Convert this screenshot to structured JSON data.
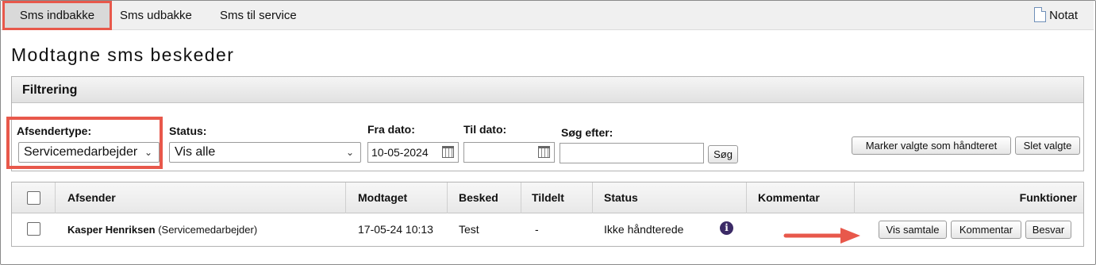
{
  "tabs": [
    {
      "label": "Sms indbakke",
      "active": true
    },
    {
      "label": "Sms udbakke",
      "active": false
    },
    {
      "label": "Sms til service",
      "active": false
    }
  ],
  "notat_label": "Notat",
  "page_title": "Modtagne sms beskeder",
  "filter": {
    "heading": "Filtrering",
    "sender_type_label": "Afsendertype:",
    "sender_type_value": "Servicemedarbejder",
    "status_label": "Status:",
    "status_value": "Vis alle",
    "from_label": "Fra dato:",
    "from_value": "10-05-2024",
    "to_label": "Til dato:",
    "to_value": "",
    "search_label": "Søg efter:",
    "search_value": "",
    "search_button": "Søg",
    "mark_handled_button": "Marker valgte som håndteret",
    "delete_button": "Slet valgte"
  },
  "table": {
    "columns": [
      "Afsender",
      "Modtaget",
      "Besked",
      "Tildelt",
      "Status",
      "Kommentar",
      "Funktioner"
    ],
    "rows": [
      {
        "sender_name": "Kasper Henriksen",
        "sender_role": "(Servicemedarbejder)",
        "received": "17-05-24 10:13",
        "message": "Test",
        "assigned": "-",
        "status": "Ikke håndterede",
        "comment": "",
        "actions": [
          "Vis samtale",
          "Kommentar",
          "Besvar"
        ]
      }
    ]
  },
  "colors": {
    "highlight": "#e8584b",
    "info_icon": "#3b2a66"
  }
}
